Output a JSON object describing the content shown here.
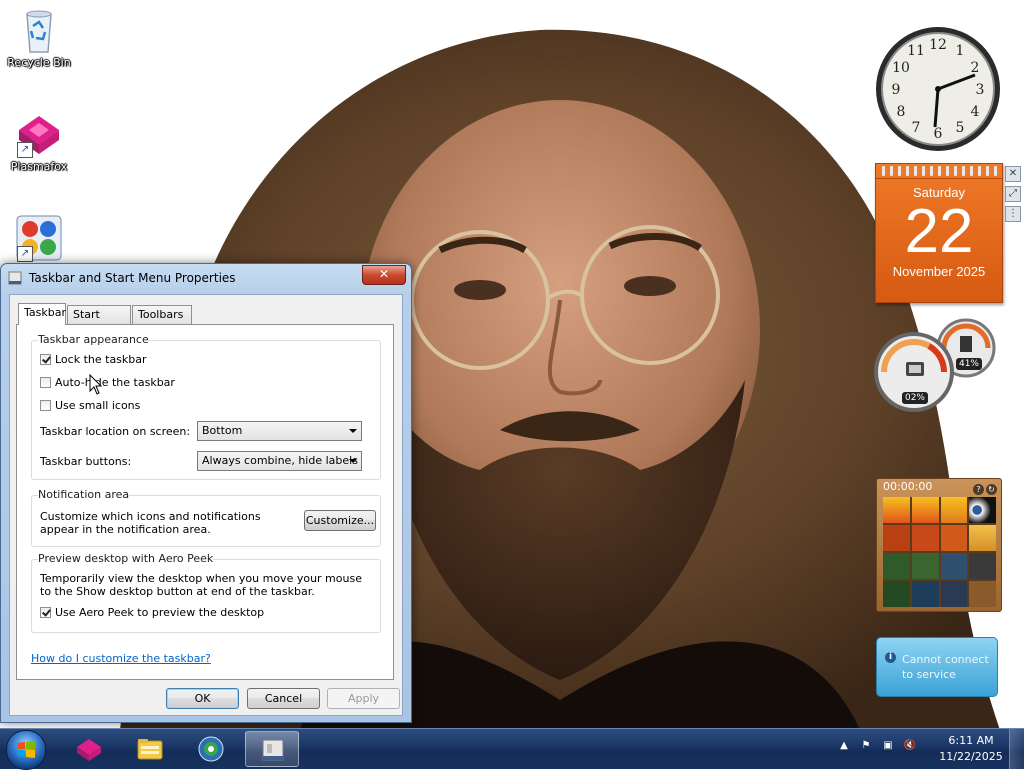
{
  "desktop": {
    "icons": [
      {
        "label": "Recycle Bin"
      },
      {
        "label": "Plasmafox"
      },
      {
        "label": ""
      }
    ]
  },
  "gadgets": {
    "clock": {
      "time_shown": "2:13"
    },
    "calendar": {
      "day": "Saturday",
      "date": "22",
      "month_year": "November 2025"
    },
    "meters": {
      "cpu": "02%",
      "memory": "41%"
    },
    "puzzle": {
      "timer": "00:00:00"
    },
    "weather": {
      "message": "Cannot connect to service"
    },
    "side_controls": {
      "close": "✕",
      "options": "⤢",
      "drag": "⋮"
    }
  },
  "dialog": {
    "title": "Taskbar and Start Menu Properties",
    "close_label": "✕",
    "tabs": [
      {
        "label": "Taskbar",
        "active": true
      },
      {
        "label": "Start Menu",
        "active": false
      },
      {
        "label": "Toolbars",
        "active": false
      }
    ],
    "appearance": {
      "heading": "Taskbar appearance",
      "lock_label": "Lock the taskbar",
      "lock_checked": true,
      "autohide_label": "Auto-hide the taskbar",
      "autohide_checked": false,
      "small_icons_label": "Use small icons",
      "small_icons_checked": false,
      "location_label": "Taskbar location on screen:",
      "location_value": "Bottom",
      "buttons_label": "Taskbar buttons:",
      "buttons_value": "Always combine, hide labels"
    },
    "notification": {
      "heading": "Notification area",
      "description": "Customize which icons and notifications appear in the notification area.",
      "customize_label": "Customize..."
    },
    "aero_peek": {
      "heading": "Preview desktop with Aero Peek",
      "description": "Temporarily view the desktop when you move your mouse to the Show desktop button at end of the taskbar.",
      "use_label": "Use Aero Peek to preview the desktop",
      "use_checked": true
    },
    "help_link": "How do I customize the taskbar?",
    "ok_label": "OK",
    "cancel_label": "Cancel",
    "apply_label": "Apply"
  },
  "taskbar": {
    "pinned": [
      "plasmafox-icon",
      "explorer-icon",
      "media-icon",
      "control-panel-icon"
    ],
    "clock": {
      "time": "6:11 AM",
      "date": "11/22/2025"
    }
  },
  "colors": {
    "taskbar": "#1b3565",
    "calendar": "#e46a1d",
    "link": "#0066cc"
  }
}
